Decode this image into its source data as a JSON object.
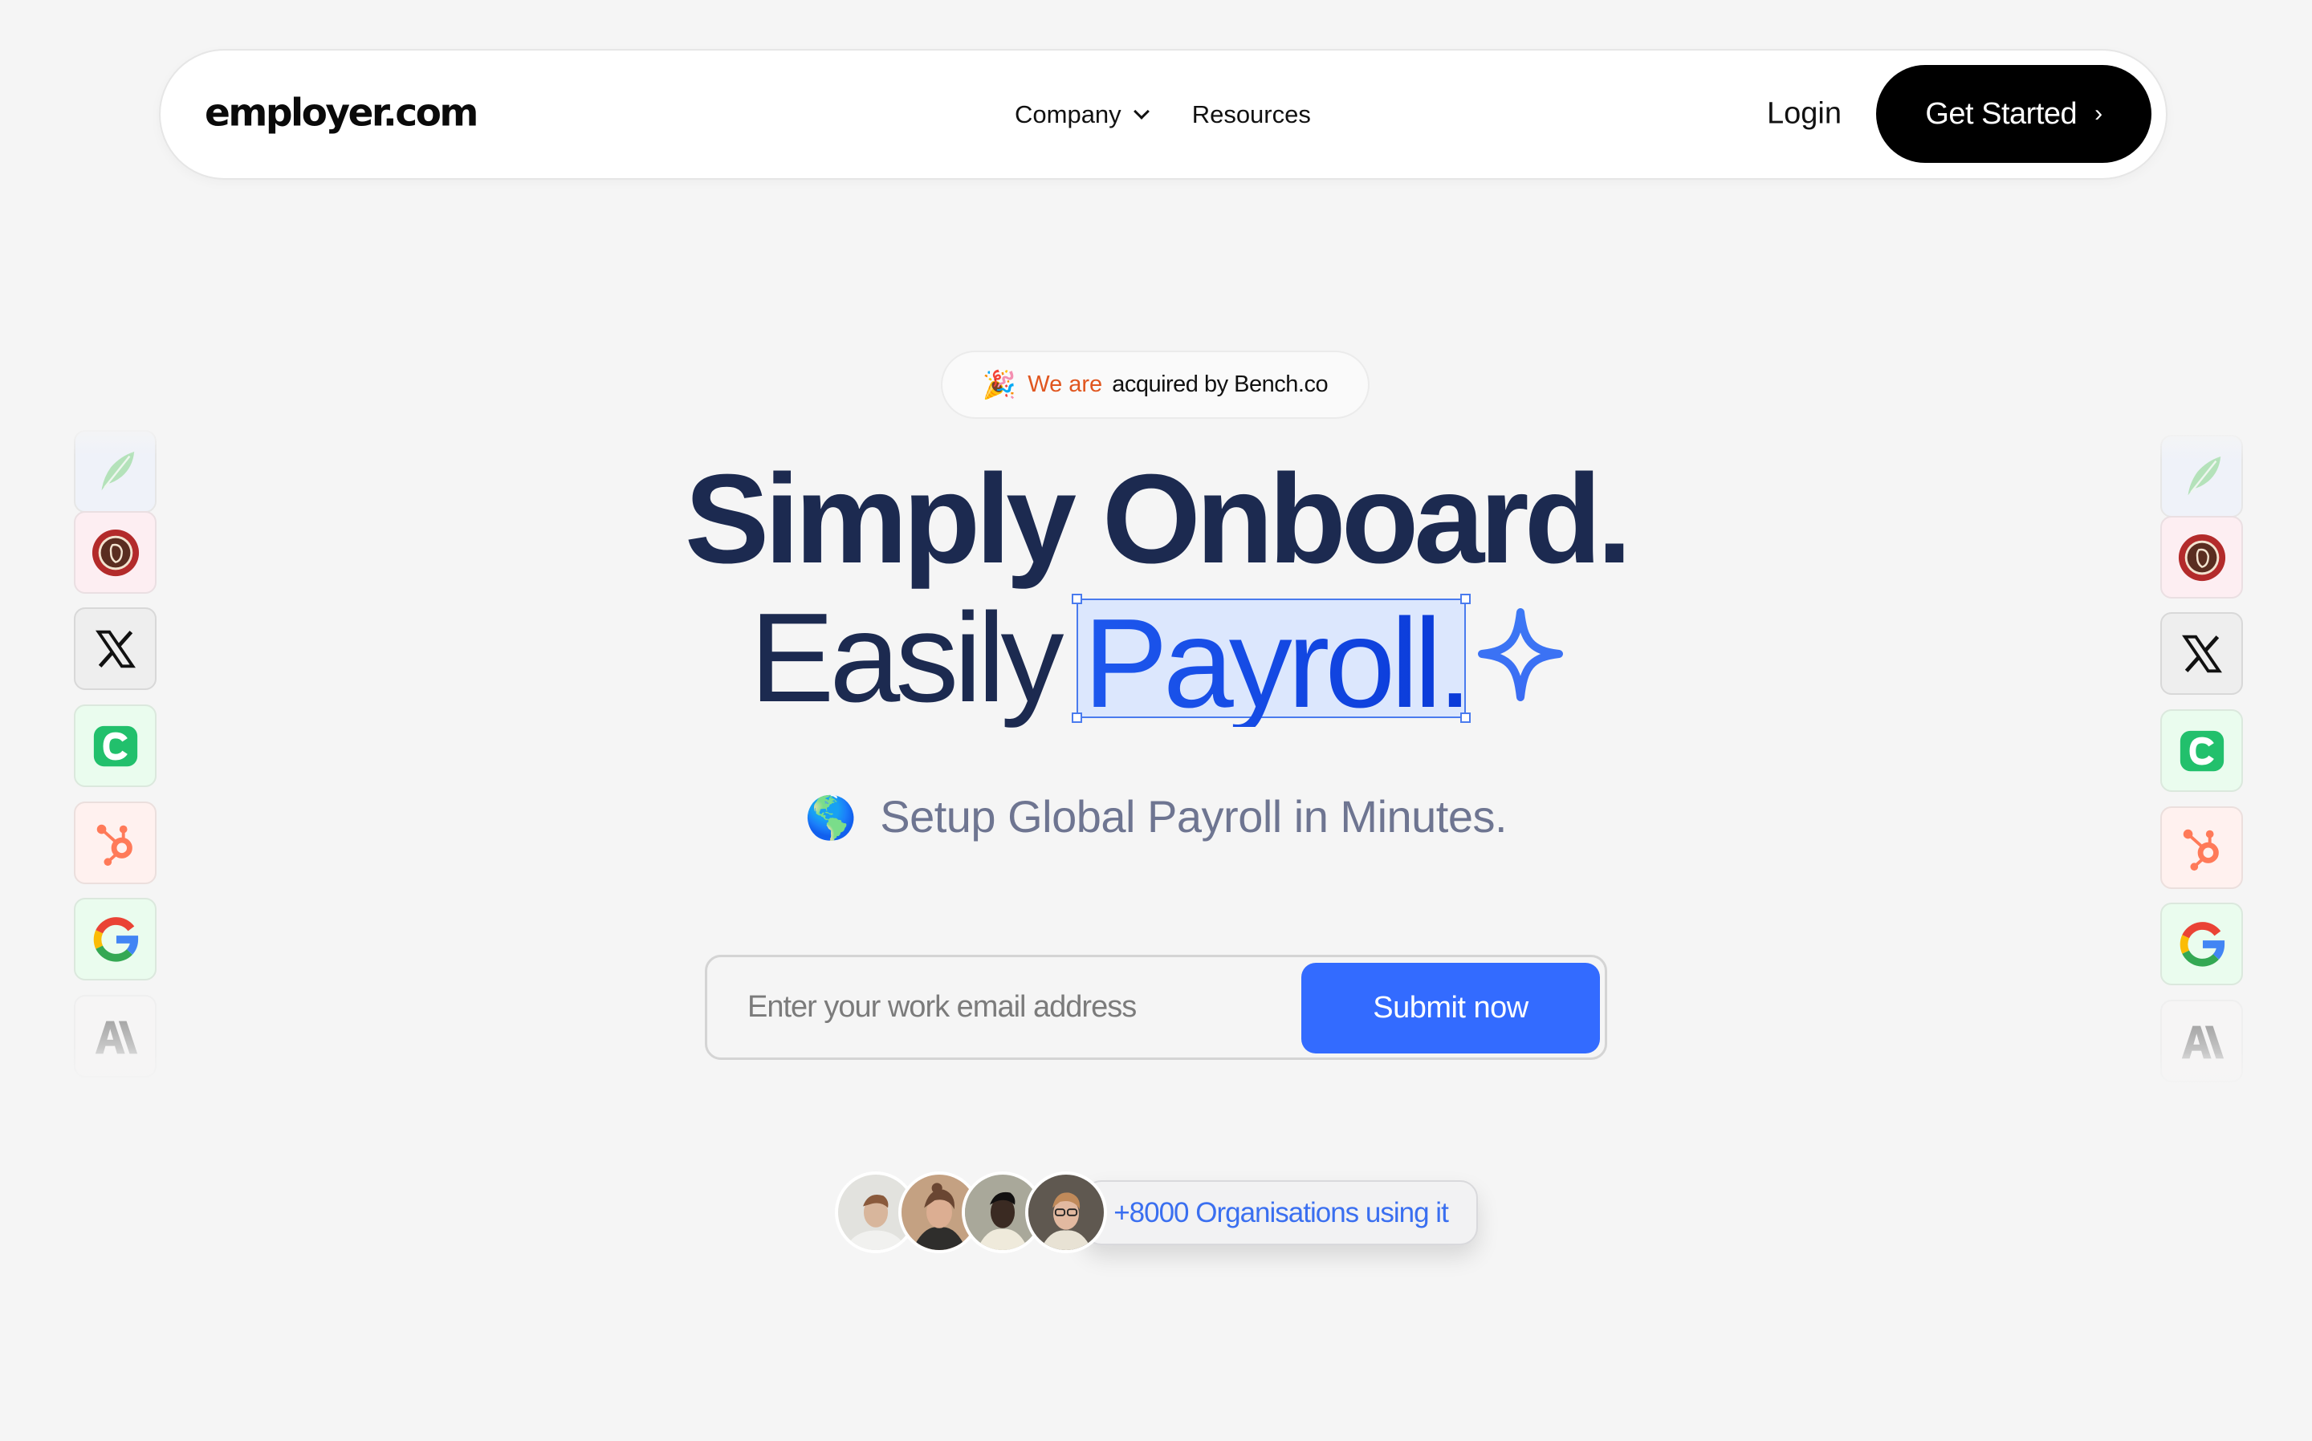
{
  "navbar": {
    "logo": "employer.com",
    "links": [
      {
        "label": "Company",
        "has_dropdown": true
      },
      {
        "label": "Resources",
        "has_dropdown": false
      }
    ],
    "login_label": "Login",
    "cta_label": "Get Started",
    "cta_icon": "chevron-right-icon"
  },
  "badge": {
    "icon": "party-popper-icon",
    "emoji": "🎉",
    "accent_text": "We are",
    "text": "acquired by Bench.co",
    "accent_color": "#e0561f"
  },
  "hero": {
    "line1": "Simply Onboard.",
    "line2_prefix": "Easily",
    "line2_highlight": "Payroll.",
    "highlight_icon": "sparkle-icon",
    "headline_color": "#1c2a50",
    "highlight_color": "#1446e0"
  },
  "subhead": {
    "icon": "globe-americas-icon",
    "emoji": "🌎",
    "text": "Setup Global Payroll in Minutes."
  },
  "email_form": {
    "value": "",
    "placeholder": "Enter your work email address",
    "submit_label": "Submit now",
    "submit_color": "#336bff"
  },
  "social_proof": {
    "avatar_count": 4,
    "counter_text": "+8000 Organisations using it"
  },
  "logo_columns": {
    "left": [
      "robinhood-logo",
      "chipotle-logo",
      "x-logo",
      "c-logo",
      "hubspot-logo",
      "google-logo",
      "anthropic-logo"
    ],
    "right": [
      "robinhood-logo",
      "chipotle-logo",
      "x-logo",
      "c-logo",
      "hubspot-logo",
      "google-logo",
      "anthropic-logo"
    ]
  }
}
